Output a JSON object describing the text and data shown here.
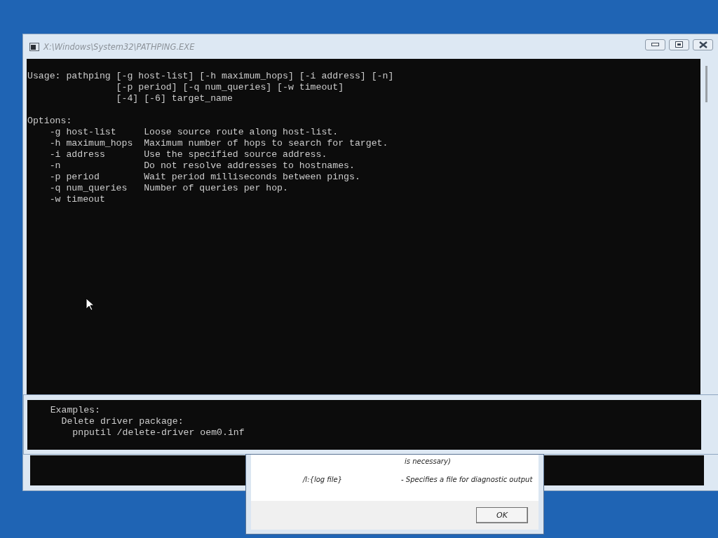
{
  "console_window": {
    "title": "X:\\Windows\\System32\\PATHPING.EXE",
    "blocks": [
      [
        "Usage: pathping [-g host-list] [-h maximum_hops] [-i address] [-n]",
        "                [-p period] [-q num_queries] [-w timeout]",
        "                [-4] [-6] target_name"
      ],
      [
        "Options:",
        "    -g host-list     Loose source route along host-list.",
        "    -h maximum_hops  Maximum number of hops to search for target.",
        "    -i address       Use the specified source address.",
        "    -n               Do not resolve addresses to hostnames.",
        "    -p period        Wait period milliseconds between pings.",
        "    -q num_queries   Number of queries per hop.",
        "    -w timeout"
      ]
    ]
  },
  "overlay_console": {
    "lines": [
      "    Examples:",
      "      Delete driver package:",
      "        pnputil /delete-driver oem0.inf"
    ]
  },
  "dialog": {
    "entries": [
      {
        "description": "is necessary)"
      },
      {
        "switch": "/l:{log file}",
        "description": "- Specifies a file for diagnostic output"
      }
    ],
    "buttons": [
      "OK"
    ]
  }
}
